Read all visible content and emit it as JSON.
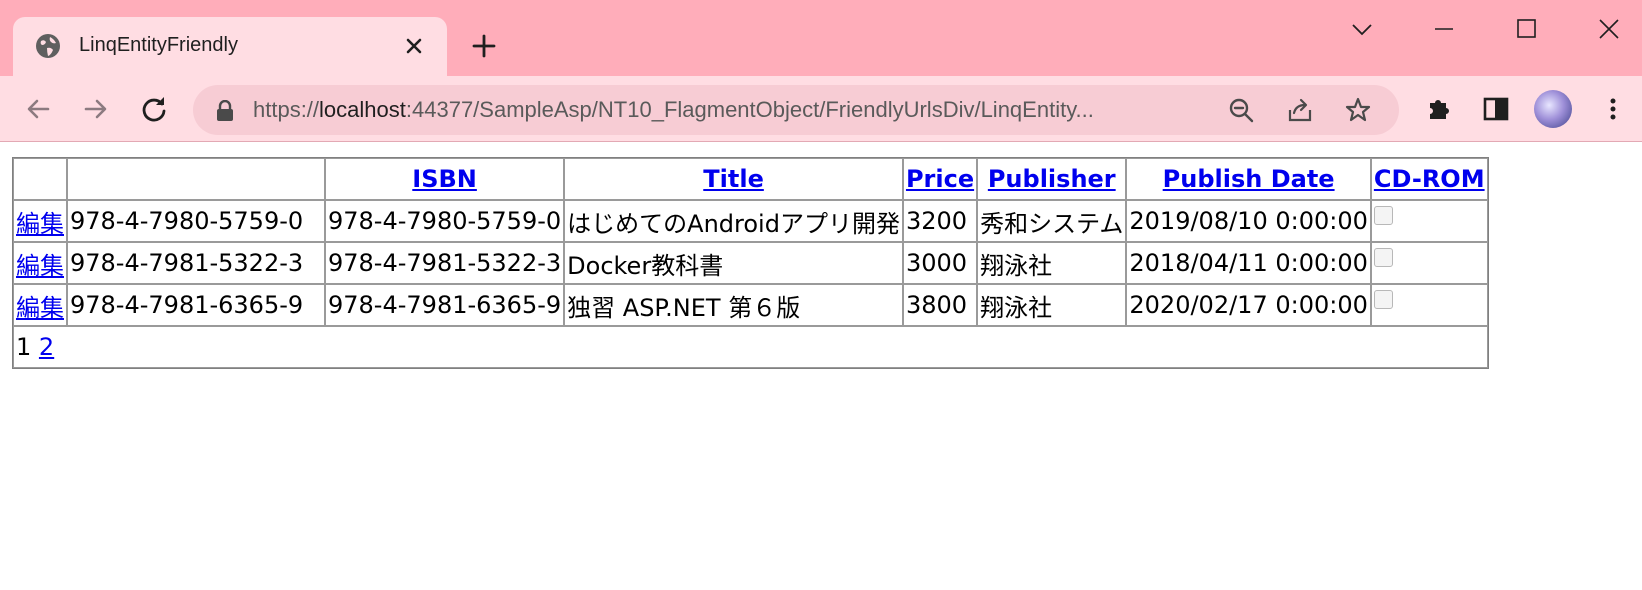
{
  "browser": {
    "tab_title": "LinqEntityFriendly",
    "url_prefix": "https://",
    "url_host": "localhost",
    "url_rest": ":44377/SampleAsp/NT10_FlagmentObject/FriendlyUrlsDiv/LinqEntity..."
  },
  "grid": {
    "headers": {
      "edit": "",
      "key": "",
      "isbn": "ISBN",
      "title": "Title",
      "price": "Price",
      "publisher": "Publisher",
      "publish_date": "Publish Date",
      "cdrom": "CD-ROM"
    },
    "rows": [
      {
        "edit": "編集",
        "key": "978-4-7980-5759-0",
        "isbn": "978-4-7980-5759-0",
        "title": "はじめてのAndroidアプリ開発",
        "price": "3200",
        "publisher": "秀和システム",
        "publish_date": "2019/08/10 0:00:00",
        "cdrom": false
      },
      {
        "edit": "編集",
        "key": "978-4-7981-5322-3",
        "isbn": "978-4-7981-5322-3",
        "title": "Docker教科書",
        "price": "3000",
        "publisher": "翔泳社",
        "publish_date": "2018/04/11 0:00:00",
        "cdrom": false
      },
      {
        "edit": "編集",
        "key": "978-4-7981-6365-9",
        "isbn": "978-4-7981-6365-9",
        "title": "独習 ASP.NET 第６版",
        "price": "3800",
        "publisher": "翔泳社",
        "publish_date": "2020/02/17 0:00:00",
        "cdrom": false
      }
    ],
    "pager": {
      "current": "1",
      "next": "2"
    }
  }
}
